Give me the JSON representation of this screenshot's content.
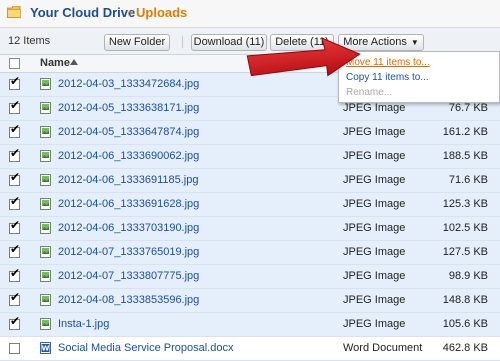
{
  "breadcrumb": {
    "root": "Your Cloud Drive",
    "separator": "›",
    "current": "Uploads"
  },
  "toolbar": {
    "item_count": "12 Items",
    "new_folder": "New Folder",
    "download": "Download (11)",
    "delete": "Delete (11)",
    "more_actions": "More Actions"
  },
  "header": {
    "name": "Name"
  },
  "menu": {
    "move": "Move 11 items to...",
    "copy": "Copy 11 items to...",
    "rename": "Rename..."
  },
  "files": [
    {
      "name": "2012-04-03_1333472684.jpg",
      "type": "",
      "size": "",
      "checked": true
    },
    {
      "name": "2012-04-05_1333638171.jpg",
      "type": "JPEG Image",
      "size": "76.7 KB",
      "checked": true
    },
    {
      "name": "2012-04-05_1333647874.jpg",
      "type": "JPEG Image",
      "size": "161.2 KB",
      "checked": true
    },
    {
      "name": "2012-04-06_1333690062.jpg",
      "type": "JPEG Image",
      "size": "188.5 KB",
      "checked": true
    },
    {
      "name": "2012-04-06_1333691185.jpg",
      "type": "JPEG Image",
      "size": "71.6 KB",
      "checked": true
    },
    {
      "name": "2012-04-06_1333691628.jpg",
      "type": "JPEG Image",
      "size": "125.3 KB",
      "checked": true
    },
    {
      "name": "2012-04-06_1333703190.jpg",
      "type": "JPEG Image",
      "size": "102.5 KB",
      "checked": true
    },
    {
      "name": "2012-04-07_1333765019.jpg",
      "type": "JPEG Image",
      "size": "127.5 KB",
      "checked": true
    },
    {
      "name": "2012-04-07_1333807775.jpg",
      "type": "JPEG Image",
      "size": "98.9 KB",
      "checked": true
    },
    {
      "name": "2012-04-08_1333853596.jpg",
      "type": "JPEG Image",
      "size": "148.8 KB",
      "checked": true
    },
    {
      "name": "Insta-1.jpg",
      "type": "JPEG Image",
      "size": "105.6 KB",
      "checked": true
    },
    {
      "name": "Social Media Service Proposal.docx",
      "type": "Word Document",
      "size": "462.8 KB",
      "checked": false
    }
  ],
  "colors": {
    "link": "#1a4f9c",
    "accent": "#e07b00",
    "selected_row": "#e5eefb",
    "arrow": "#d0161b"
  }
}
